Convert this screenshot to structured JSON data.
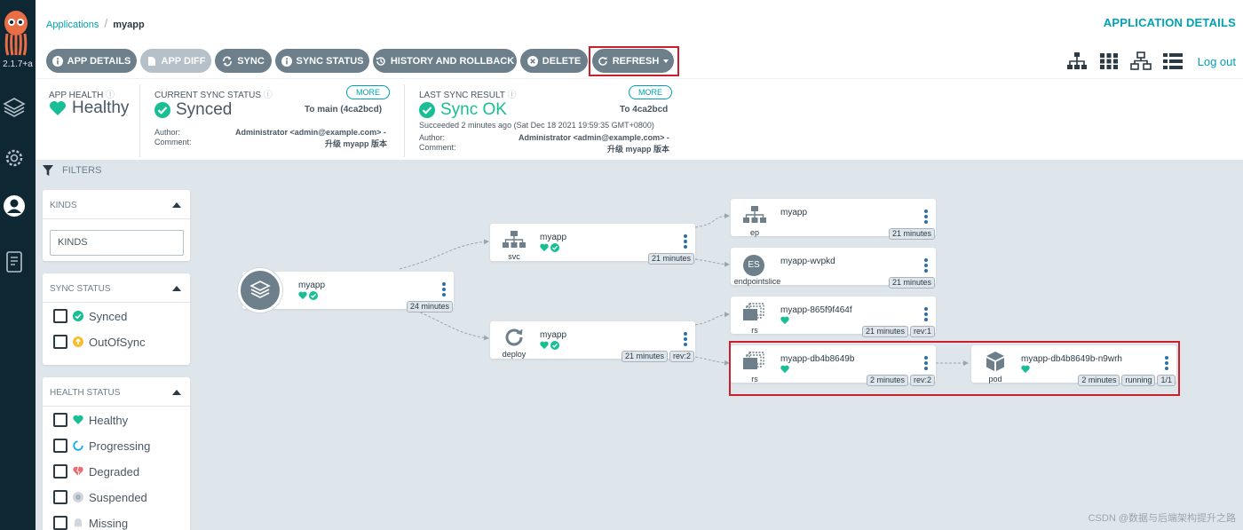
{
  "nav": {
    "version": "2.1.7+a"
  },
  "breadcrumb": {
    "root": "Applications",
    "current": "myapp"
  },
  "page_title": "APPLICATION DETAILS",
  "toolbar": {
    "app_details": "APP DETAILS",
    "app_diff": "APP DIFF",
    "sync": "SYNC",
    "sync_status": "SYNC STATUS",
    "history": "HISTORY AND ROLLBACK",
    "delete": "DELETE",
    "refresh": "REFRESH",
    "logout": "Log out"
  },
  "status": {
    "app_health": {
      "label": "APP HEALTH",
      "value": "Healthy"
    },
    "sync_status": {
      "label": "CURRENT SYNC STATUS",
      "value": "Synced",
      "more": "MORE",
      "target": "To main (4ca2bcd)",
      "author_label": "Author:",
      "author": "Administrator <admin@example.com> -",
      "comment_label": "Comment:",
      "comment": "升级 myapp 版本"
    },
    "last_sync": {
      "label": "LAST SYNC RESULT",
      "value": "Sync OK",
      "more": "MORE",
      "target": "To 4ca2bcd",
      "succeeded": "Succeeded 2 minutes ago (Sat Dec 18 2021 19:59:35 GMT+0800)",
      "author_label": "Author:",
      "author": "Administrator <admin@example.com> -",
      "comment_label": "Comment:",
      "comment": "升级 myapp 版本"
    }
  },
  "filters": {
    "title": "FILTERS",
    "kinds": {
      "title": "KINDS",
      "placeholder": "KINDS"
    },
    "sync_status": {
      "title": "SYNC STATUS",
      "options": [
        "Synced",
        "OutOfSync"
      ]
    },
    "health_status": {
      "title": "HEALTH STATUS",
      "options": [
        "Healthy",
        "Progressing",
        "Degraded",
        "Suspended",
        "Missing"
      ]
    }
  },
  "graph": {
    "app": {
      "name": "myapp",
      "age": "24 minutes"
    },
    "svc": {
      "name": "myapp",
      "kind": "svc",
      "age": "21 minutes"
    },
    "deploy": {
      "name": "myapp",
      "kind": "deploy",
      "age": "21 minutes",
      "rev": "rev:2"
    },
    "ep": {
      "name": "myapp",
      "kind": "ep",
      "age": "21 minutes"
    },
    "endpointslice": {
      "name": "myapp-wvpkd",
      "kind": "endpointslice",
      "icon_text": "ES",
      "age": "21 minutes"
    },
    "rs1": {
      "name": "myapp-865f9f464f",
      "kind": "rs",
      "age": "21 minutes",
      "rev": "rev:1"
    },
    "rs2": {
      "name": "myapp-db4b8649b",
      "kind": "rs",
      "age": "2 minutes",
      "rev": "rev:2"
    },
    "pod": {
      "name": "myapp-db4b8649b-n9wrh",
      "kind": "pod",
      "age": "2 minutes",
      "state": "running",
      "ready": "1/1"
    }
  },
  "watermark": "CSDN @数据与后端架构提升之路",
  "colors": {
    "nav_bg": "#0f2733",
    "button": "#6d7f8b",
    "accent": "#00a2b3",
    "healthy": "#18be94",
    "highlight": "#cc1f2e",
    "canvas": "#dee6eb"
  }
}
